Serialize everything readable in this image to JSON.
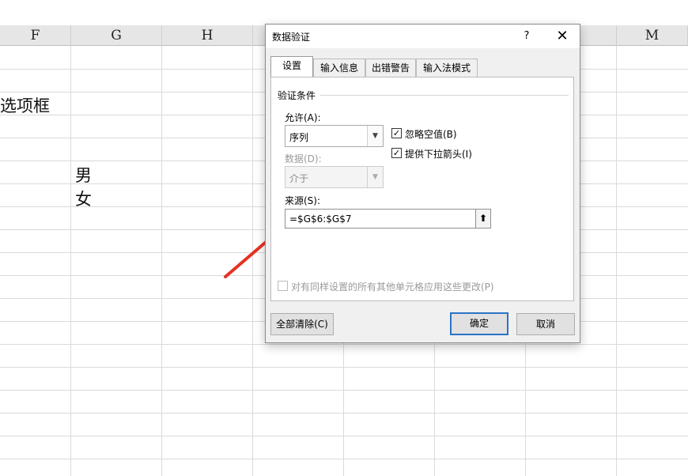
{
  "sheet": {
    "columns": [
      "F",
      "G",
      "H",
      "M"
    ],
    "cells": {
      "f_label": "选项框",
      "g6": "男",
      "g7": "女"
    }
  },
  "dialog": {
    "title": "数据验证",
    "help": "?",
    "close": "✕",
    "tabs": [
      "设置",
      "输入信息",
      "出错警告",
      "输入法模式"
    ],
    "group_title": "验证条件",
    "allow_label": "允许(A):",
    "allow_value": "序列",
    "ignore_blank_label": "忽略空值(B)",
    "ignore_blank_checked": true,
    "dropdown_label": "提供下拉箭头(I)",
    "dropdown_checked": true,
    "data_label": "数据(D):",
    "data_value": "介于",
    "source_label": "来源(S):",
    "source_value": "=$G$6:$G$7",
    "apply_all_label": "对有同样设置的所有其他单元格应用这些更改(P)",
    "apply_all_checked": false,
    "clear_all": "全部清除(C)",
    "ok": "确定",
    "cancel": "取消"
  },
  "colors": {
    "accent": "#2b73c6",
    "arrow": "#e53222"
  },
  "icons": {
    "dropdown": "chevron-down-icon",
    "collapse": "collapse-up-icon",
    "check": "check-icon"
  }
}
